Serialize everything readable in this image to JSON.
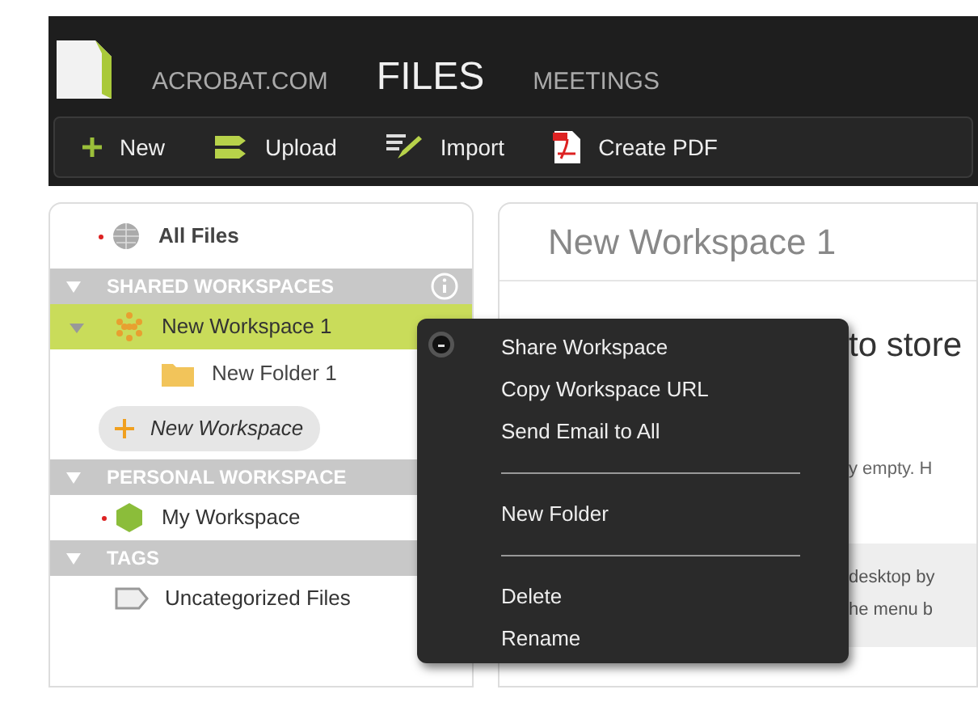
{
  "header": {
    "nav": [
      {
        "label": "ACROBAT.COM",
        "selected": false
      },
      {
        "label": "FILES",
        "selected": true
      },
      {
        "label": "MEETINGS",
        "selected": false
      }
    ],
    "toolbar": [
      {
        "label": "New",
        "kind": "new"
      },
      {
        "label": "Upload",
        "kind": "upload"
      },
      {
        "label": "Import",
        "kind": "import"
      },
      {
        "label": "Create PDF",
        "kind": "pdf"
      }
    ]
  },
  "sidebar": {
    "all_files": "All Files",
    "sections": [
      {
        "title": "SHARED WORKSPACES",
        "items": [
          {
            "label": "New Workspace 1",
            "kind": "shared",
            "selected": true,
            "expanded": true,
            "children": [
              {
                "label": "New Folder 1",
                "kind": "folder",
                "selected": false
              }
            ]
          }
        ],
        "add_button": "New Workspace"
      },
      {
        "title": "PERSONAL WORKSPACE",
        "items": [
          {
            "label": "My Workspace",
            "kind": "personal",
            "selected": false
          }
        ]
      },
      {
        "title": "TAGS",
        "items": [
          {
            "label": "Uncategorized Files",
            "kind": "tag",
            "selected": false
          }
        ]
      }
    ]
  },
  "main": {
    "title": "New Workspace 1",
    "heading": "to store",
    "text": "y empty. H",
    "hint_lines": [
      "desktop by",
      "he menu b"
    ]
  },
  "context_menu": {
    "groups": [
      [
        "Share Workspace",
        "Copy Workspace URL",
        "Send Email to All"
      ],
      [
        "New Folder"
      ],
      [
        "Delete",
        "Rename"
      ]
    ]
  }
}
